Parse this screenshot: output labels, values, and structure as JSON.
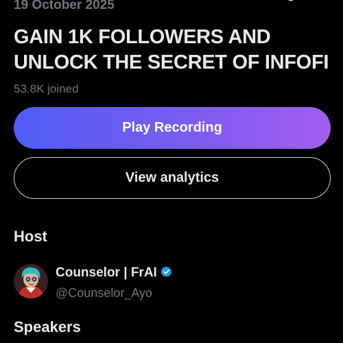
{
  "space": {
    "date": "19 October 2025",
    "title": "GAIN 1K FOLLOWERS AND UNLOCK THE SECRET OF INFOFI",
    "joined": "53.8K joined"
  },
  "actions": {
    "play_recording": "Play Recording",
    "view_analytics": "View analytics"
  },
  "host": {
    "heading": "Host",
    "name": "Counselor | FrAI",
    "handle": "@Counselor_Ayo",
    "verified_icon": "verified-badge-icon",
    "verified_color": "#1d9bf0"
  },
  "speakers": {
    "heading": "Speakers"
  },
  "colors": {
    "background": "#000000",
    "primary_text": "#e7e9ea",
    "secondary_text": "#71767b",
    "button_gradient_start": "#4f5cf5",
    "button_gradient_end": "#a45ef0"
  },
  "icons": {
    "share": "share-icon"
  }
}
